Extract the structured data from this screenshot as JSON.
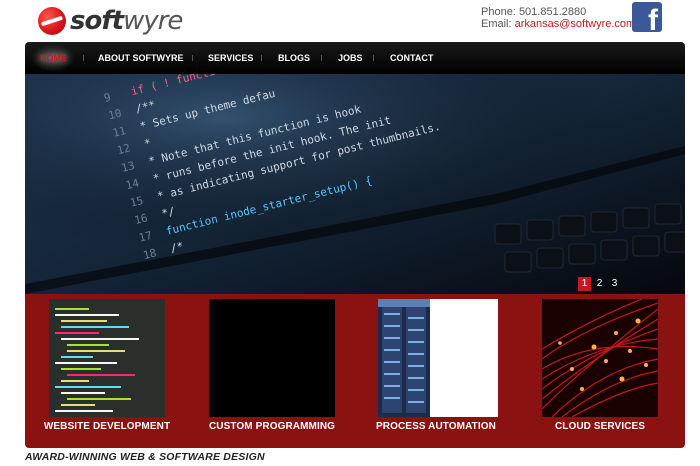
{
  "brand": {
    "name_prefix": "soft",
    "name_suffix": "wyre"
  },
  "contact": {
    "phone_label": "Phone:",
    "phone": "501.851.2880",
    "email_label": "Email:",
    "email": "arkansas@softwyre.com"
  },
  "social": {
    "facebook_glyph": "f"
  },
  "nav": {
    "items": [
      {
        "label": "HOME"
      },
      {
        "label": "ABOUT SOFTWYRE"
      },
      {
        "label": "SERVICES"
      },
      {
        "label": "BLOGS"
      },
      {
        "label": "JOBS"
      },
      {
        "label": "CONTACT"
      }
    ],
    "active_index": 0
  },
  "hero": {
    "slides": [
      "1",
      "2",
      "3"
    ],
    "active_slide": 1,
    "code_lines": [
      {
        "num": "9",
        "text": "if ( ! functi"
      },
      {
        "num": "10",
        "text": "/**"
      },
      {
        "num": "11",
        "text": " * Sets up theme defau"
      },
      {
        "num": "12",
        "text": " *"
      },
      {
        "num": "13",
        "text": " * Note that this function is hook"
      },
      {
        "num": "14",
        "text": " * runs before the init hook. The init"
      },
      {
        "num": "15",
        "text": " * as indicating support for post thumbnails."
      },
      {
        "num": "16",
        "text": " */"
      },
      {
        "num": "17",
        "text": "function inode_starter_setup() {"
      },
      {
        "num": "18",
        "text": "  /*"
      }
    ]
  },
  "services": [
    {
      "label": "WEBSITE DEVELOPMENT",
      "icon": "code-screen-image"
    },
    {
      "label": "CUSTOM PROGRAMMING",
      "icon": "black-image"
    },
    {
      "label": "PROCESS AUTOMATION",
      "icon": "server-rack-image"
    },
    {
      "label": "CLOUD SERVICES",
      "icon": "fiber-optic-image"
    }
  ],
  "tagline": "AWARD-WINNING WEB & SOFTWARE DESIGN",
  "colors": {
    "accent": "#c8171e",
    "band": "#8a1210",
    "nav": "#000000",
    "facebook": "#3b5998"
  }
}
